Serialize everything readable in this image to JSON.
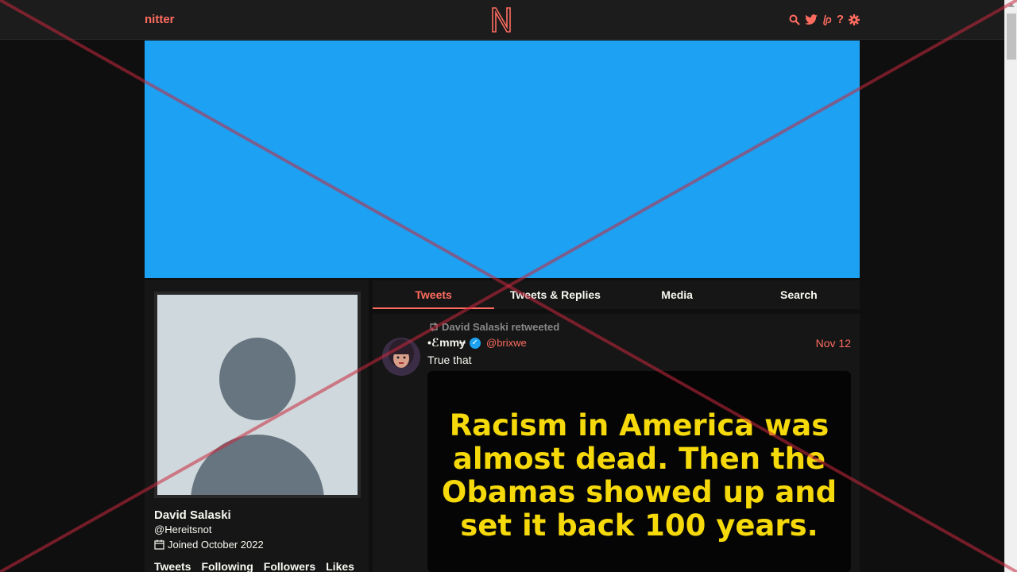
{
  "nav": {
    "brand": "nitter"
  },
  "profile": {
    "fullname": "David Salaski",
    "username": "@Hereitsnot",
    "joined": "Joined October 2022",
    "stats": [
      "Tweets",
      "Following",
      "Followers",
      "Likes"
    ]
  },
  "tabs": [
    "Tweets",
    "Tweets & Replies",
    "Media",
    "Search"
  ],
  "tweet": {
    "retweet_header": "David Salaski retweeted",
    "fullname": "•ℰmmɏ",
    "username": "@brixwe",
    "date": "Nov 12",
    "text": "True that",
    "image_text": "Racism in America was almost dead. Then the Obamas showed up and set it back 100 years."
  },
  "colors": {
    "accent": "#ff6c60",
    "banner": "#1da1f2",
    "background": "#0f0f0f",
    "panel": "#161616",
    "image_text": "#f5d90a"
  },
  "icons": [
    "search-icon",
    "twitter-icon",
    "liberapay-icon",
    "help-icon",
    "settings-icon",
    "retweet-icon",
    "calendar-icon",
    "verified-icon"
  ]
}
